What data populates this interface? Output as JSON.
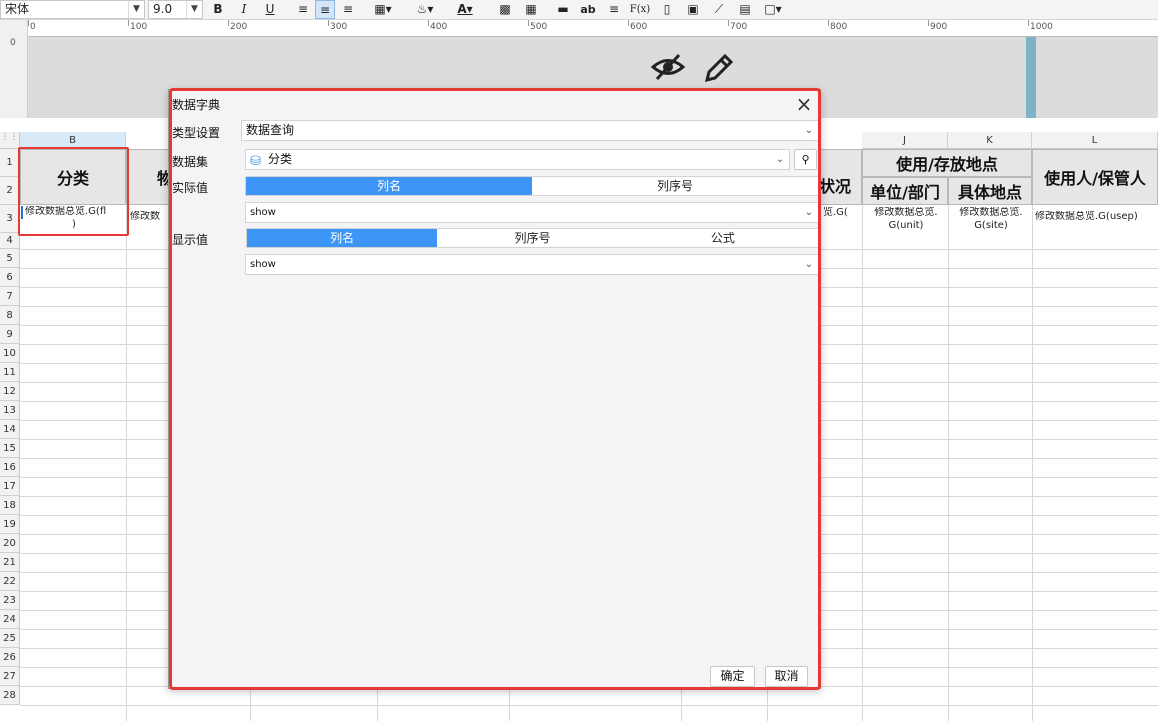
{
  "toolbar": {
    "font_name": "宋体",
    "font_size": "9.0",
    "bold": "B",
    "italic": "I",
    "underline": "U",
    "text_color": "A",
    "ab_label": "ab",
    "formula_label": "F(x)"
  },
  "ruler": {
    "ticks": [
      "0",
      "100",
      "200",
      "300",
      "400",
      "500",
      "600",
      "700",
      "800",
      "900",
      "1000"
    ]
  },
  "spreadsheet": {
    "col_b": "B",
    "col_j": "J",
    "col_k": "K",
    "col_l": "L",
    "row_numbers": [
      "1",
      "2",
      "3",
      "4",
      "5",
      "6",
      "7",
      "8",
      "9",
      "10",
      "11",
      "12",
      "13",
      "14",
      "15",
      "16",
      "17",
      "18",
      "19",
      "20",
      "21",
      "22",
      "23",
      "24",
      "25",
      "26",
      "27",
      "28"
    ],
    "header_fenlei": "分类",
    "header_wu": "物",
    "header_zhuangkuang": "状况",
    "header_location": "使用/存放地点",
    "header_unit": "单位/部门",
    "header_site": "具体地点",
    "header_user": "使用人/保管人",
    "cell_b3_line1": "修改数据总览.G(fl",
    "cell_b3_line2": ")",
    "cell_c3": "修改数",
    "cell_i3": "览.G(",
    "cell_j3_line1": "修改数据总览.",
    "cell_j3_line2": "G(unit)",
    "cell_k3_line1": "修改数据总览.",
    "cell_k3_line2": "G(site)",
    "cell_l3": "修改数据总览.G(usep)"
  },
  "dialog": {
    "title": "数据字典",
    "type_label": "类型设置",
    "type_value": "数据查询",
    "dataset_label": "数据集",
    "dataset_value": "分类",
    "actual_label": "实际值",
    "actual_tabs": [
      "列名",
      "列序号"
    ],
    "actual_field_value": "show",
    "display_label": "显示值",
    "display_tabs": [
      "列名",
      "列序号",
      "公式"
    ],
    "display_field_value": "show",
    "ok_label": "确定",
    "cancel_label": "取消"
  }
}
